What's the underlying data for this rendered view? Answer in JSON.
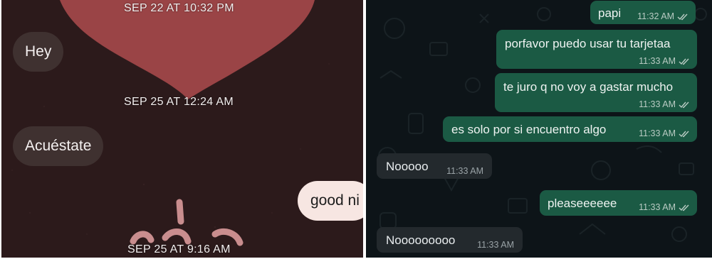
{
  "left_chat": {
    "timestamps": [
      "SEP 22 AT 10:32 PM",
      "SEP 25 AT 12:24 AM",
      "SEP 25 AT 9:16 AM"
    ],
    "incoming": [
      "Hey",
      "Acuéstate"
    ],
    "outgoing": [
      "good ni"
    ],
    "colors": {
      "background": "#2c1a1b",
      "heart": "#9a4446",
      "bubble_in": "#3f3130",
      "bubble_out": "#f7e6e2"
    }
  },
  "right_chat": {
    "messages": [
      {
        "direction": "out",
        "text": "papi",
        "time": "11:32 AM"
      },
      {
        "direction": "out",
        "text": "porfavor puedo usar tu tarjetaa",
        "time": "11:33 AM"
      },
      {
        "direction": "out",
        "text": "te juro q no voy a gastar mucho",
        "time": "11:33 AM"
      },
      {
        "direction": "out",
        "text": "es solo por si encuentro algo",
        "time": "11:33 AM"
      },
      {
        "direction": "in",
        "text": "Nooooo",
        "time": "11:33 AM"
      },
      {
        "direction": "out",
        "text": "pleaseeeeee",
        "time": "11:33 AM"
      },
      {
        "direction": "in",
        "text": "Nooooooooo",
        "time": "11:33 AM"
      }
    ],
    "icons": {
      "read_receipt": "double-check-icon"
    },
    "colors": {
      "background": "#0d1418",
      "bubble_out": "#1b5a44",
      "bubble_in": "#23292d"
    }
  }
}
